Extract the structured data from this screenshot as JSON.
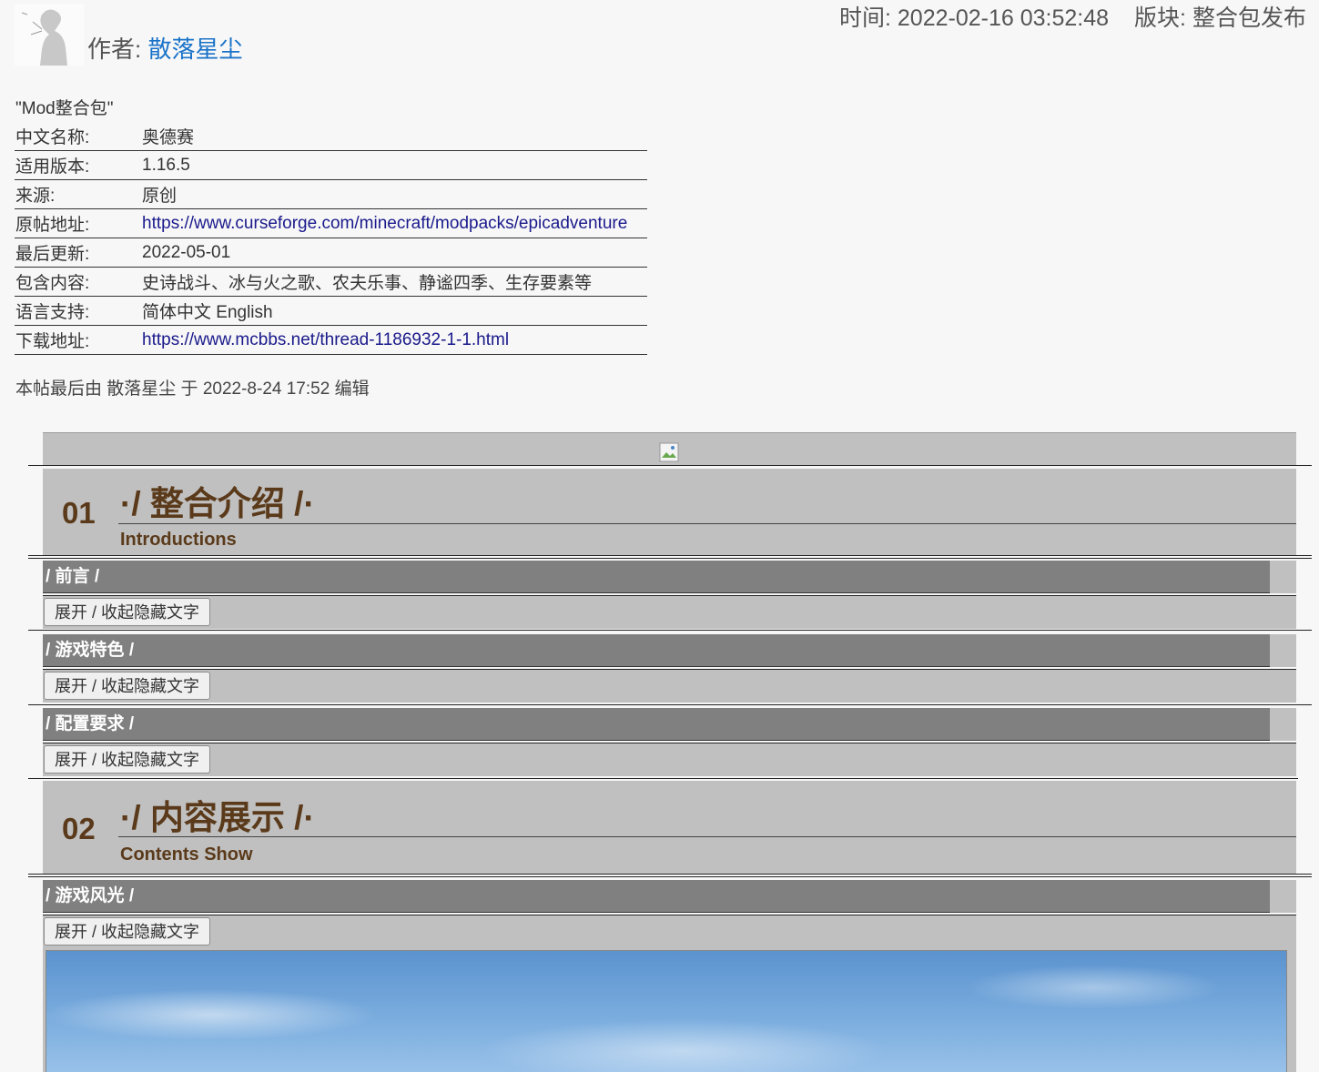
{
  "header": {
    "author_label": "作者: ",
    "author_name": "散落星尘",
    "time_label": "时间: 2022-02-16 03:52:48",
    "board_label": "版块: 整合包发布"
  },
  "pack": {
    "title": "\"Mod整合包\"",
    "rows": [
      {
        "key": "中文名称:",
        "value": "奥德赛",
        "link": false
      },
      {
        "key": "适用版本:",
        "value": "1.16.5",
        "link": false
      },
      {
        "key": "来源:",
        "value": "原创",
        "link": false
      },
      {
        "key": "原帖地址:",
        "value": "https://www.curseforge.com/minecraft/modpacks/epicadventure",
        "link": true
      },
      {
        "key": "最后更新:",
        "value": "2022-05-01",
        "link": false
      },
      {
        "key": "包含内容:",
        "value": "史诗战斗、冰与火之歌、农夫乐事、静谧四季、生存要素等",
        "link": false
      },
      {
        "key": "语言支持:",
        "value": "简体中文 English",
        "link": false
      },
      {
        "key": "下载地址:",
        "value": "https://www.mcbbs.net/thread-1186932-1-1.html",
        "link": true
      }
    ],
    "edit_note": "本帖最后由 散落星尘 于 2022-8-24 17:52 编辑"
  },
  "sections": {
    "intro": {
      "num": "01",
      "title": "·/ 整合介绍 /·",
      "subtitle": "Introductions"
    },
    "show": {
      "num": "02",
      "title": "·/ 内容展示 /·",
      "subtitle": "Contents Show"
    },
    "bars": [
      "/ 前言 /",
      "/ 游戏特色 /",
      "/ 配置要求 /",
      "/ 游戏风光 /"
    ],
    "toggle_label": "展开 / 收起隐藏文字"
  },
  "colors": {
    "accent": "#1a73c9",
    "heading": "#5a3a1a",
    "bar": "#808080",
    "panel": "#c0c0c0"
  },
  "icons": [
    "avatar-image",
    "broken-image-icon"
  ]
}
